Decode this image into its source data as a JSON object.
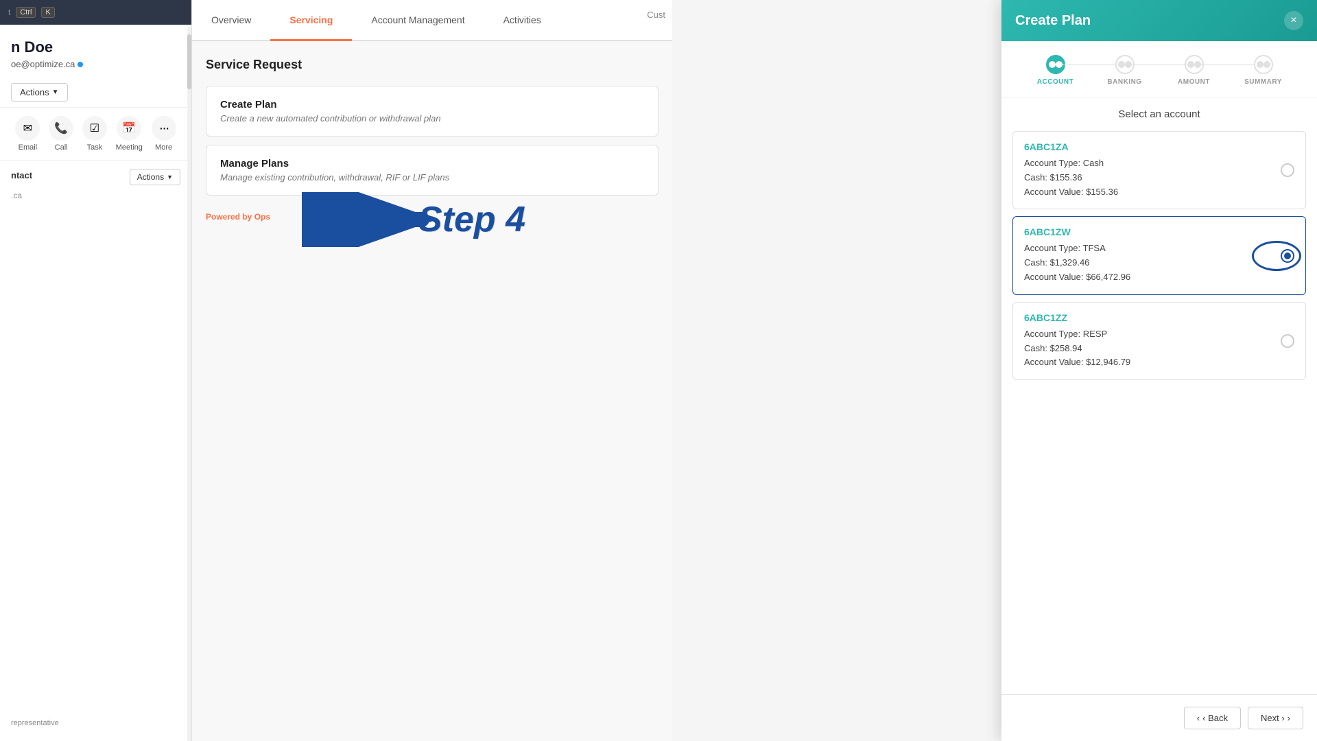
{
  "topBar": {
    "shortcut": "Ctrl",
    "shortcutKey": "K"
  },
  "contact": {
    "name": "n Doe",
    "email": "oe@optimize.ca",
    "actionsLabel": "Actions"
  },
  "iconRow": [
    {
      "name": "email-icon",
      "symbol": "✉",
      "label": "Email"
    },
    {
      "name": "call-icon",
      "symbol": "📞",
      "label": "Call"
    },
    {
      "name": "task-icon",
      "symbol": "☑",
      "label": "Task"
    },
    {
      "name": "meeting-icon",
      "symbol": "📅",
      "label": "Meeting"
    },
    {
      "name": "more-icon",
      "symbol": "•••",
      "label": "More"
    }
  ],
  "contactSection": {
    "title": "ntact",
    "actionsLabel": "Actions"
  },
  "tabs": [
    {
      "id": "overview",
      "label": "Overview",
      "active": false
    },
    {
      "id": "servicing",
      "label": "Servicing",
      "active": true
    },
    {
      "id": "account-management",
      "label": "Account Management",
      "active": false
    },
    {
      "id": "activities",
      "label": "Activities",
      "active": false
    }
  ],
  "custLabel": "Cust",
  "serviceRequest": {
    "title": "Service Request",
    "cards": [
      {
        "id": "create-plan",
        "title": "Create Plan",
        "description": "Create a new automated contribution or withdrawal plan"
      },
      {
        "id": "manage-plans",
        "title": "Manage Plans",
        "description": "Manage existing contribution, withdrawal, RIF or LIF plans"
      }
    ]
  },
  "poweredBy": {
    "prefix": "Powered by ",
    "brand": "Ops"
  },
  "stepAnnotation": {
    "text": "Step 4"
  },
  "createPlan": {
    "title": "Create Plan",
    "closeLabel": "×",
    "stepper": [
      {
        "id": "account",
        "label": "ACCOUNT",
        "active": true
      },
      {
        "id": "banking",
        "label": "BANKING",
        "active": false
      },
      {
        "id": "amount",
        "label": "AMOUNT",
        "active": false
      },
      {
        "id": "summary",
        "label": "SUMMARY",
        "active": false
      }
    ],
    "selectAccountTitle": "Select an account",
    "accounts": [
      {
        "id": "6ABC1ZA",
        "type": "Cash",
        "typeLabel": "Account Type: Cash",
        "cashLabel": "Cash:",
        "cashValue": "$155.36",
        "valueLabel": "Account Value:",
        "accountValue": "$155.36",
        "selected": false
      },
      {
        "id": "6ABC1ZW",
        "type": "TFSA",
        "typeLabel": "Account Type: TFSA",
        "cashLabel": "Cash:",
        "cashValue": "$1,329.46",
        "valueLabel": "Account Value:",
        "accountValue": "$66,472.96",
        "selected": true
      },
      {
        "id": "6ABC1ZZ",
        "type": "RESP",
        "typeLabel": "Account Type: RESP",
        "cashLabel": "Cash:",
        "cashValue": "$258.94",
        "valueLabel": "Account Value:",
        "accountValue": "$12,946.79",
        "selected": false
      }
    ],
    "footer": {
      "backLabel": "‹ Back",
      "nextLabel": "Next ›"
    }
  },
  "repLabel": "representative"
}
